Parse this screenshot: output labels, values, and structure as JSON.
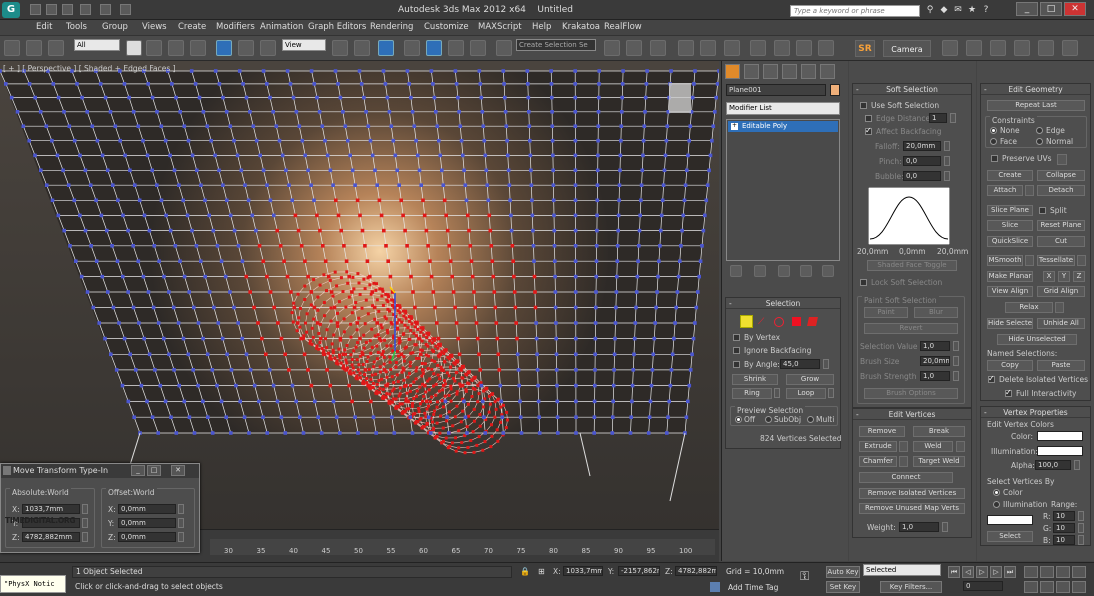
{
  "app": {
    "title": "Autodesk 3ds Max  2012 x64",
    "file": "Untitled",
    "search_placeholder": "Type a keyword or phrase"
  },
  "menu": [
    "Edit",
    "Tools",
    "Group",
    "Views",
    "Create",
    "Modifiers",
    "Animation",
    "Graph Editors",
    "Rendering",
    "Customize",
    "MAXScript",
    "Help",
    "Krakatoa",
    "RealFlow"
  ],
  "toolbar": {
    "selection_filter": "All",
    "ref_coord": "View",
    "named_selection": "Create Selection Se",
    "sr_label": "SR",
    "camera_label": "Camera"
  },
  "viewport": {
    "label": "[ + ] [ Perspective ] [ Shaded + Edged Faces ]"
  },
  "timeline": {
    "ticks": [
      "30",
      "35",
      "40",
      "45",
      "50",
      "55",
      "60",
      "65",
      "70",
      "75",
      "80",
      "85",
      "90",
      "95",
      "100"
    ]
  },
  "move_transform": {
    "title": "Move Transform Type-In",
    "absolute_label": "Absolute:World",
    "offset_label": "Offset:World",
    "abs_x": "1033,7mm",
    "abs_y": "",
    "abs_z": "4782,882mm",
    "off_x": "0,0mm",
    "off_y": "0,0mm",
    "off_z": "0,0mm",
    "x": "X:",
    "y": "Y:",
    "z": "Z:",
    "watermark": "TIMEDIGITAL.ORG"
  },
  "status": {
    "physx_notice": "\"PhysX Notic",
    "objects_selected": "1 Object Selected",
    "prompt": "Click or click-and-drag to select objects",
    "x": "1033,7mm",
    "y": "-2157,862r",
    "z": "4782,882m",
    "grid": "Grid = 10,0mm",
    "add_time_tag": "Add Time Tag",
    "auto_key": "Auto Key",
    "set_key": "Set Key",
    "selected": "Selected",
    "key_filters": "Key Filters...",
    "frame": "0"
  },
  "command_panel": {
    "object_name": "Plane001",
    "modifier_list": "Modifier List",
    "stack_item": "Editable Poly"
  },
  "selection_rollout": {
    "title": "Selection",
    "by_vertex": "By Vertex",
    "ignore_backfacing": "Ignore Backfacing",
    "by_angle": "By Angle:",
    "by_angle_value": "45,0",
    "shrink": "Shrink",
    "grow": "Grow",
    "ring": "Ring",
    "loop": "Loop",
    "preview_selection": "Preview Selection",
    "off": "Off",
    "subobj": "SubObj",
    "multi": "Multi",
    "count": "824 Vertices Selected"
  },
  "soft_selection": {
    "title": "Soft Selection",
    "use_soft_selection": "Use Soft Selection",
    "edge_distance": "Edge Distance:",
    "edge_distance_value": "1",
    "affect_backfacing": "Affect Backfacing",
    "falloff": "Falloff:",
    "falloff_value": "20,0mm",
    "pinch": "Pinch:",
    "pinch_value": "0,0",
    "bubble": "Bubble:",
    "bubble_value": "0,0",
    "curve_left": "20,0mm",
    "curve_mid": "0,0mm",
    "curve_right": "20,0mm",
    "shaded_face_toggle": "Shaded Face Toggle",
    "lock_soft_selection": "Lock Soft Selection",
    "paint_soft_selection": "Paint Soft Selection",
    "paint": "Paint",
    "blur": "Blur",
    "revert": "Revert",
    "selection_value": "Selection Value",
    "selection_value_v": "1,0",
    "brush_size": "Brush Size",
    "brush_size_v": "20,0mm",
    "brush_strength": "Brush Strength",
    "brush_strength_v": "1,0",
    "brush_options": "Brush Options"
  },
  "edit_vertices": {
    "title": "Edit Vertices",
    "remove": "Remove",
    "break": "Break",
    "extrude": "Extrude",
    "weld": "Weld",
    "chamfer": "Chamfer",
    "target_weld": "Target Weld",
    "connect": "Connect",
    "remove_isolated": "Remove Isolated Vertices",
    "remove_unused": "Remove Unused Map Verts",
    "weight": "Weight:",
    "weight_value": "1,0"
  },
  "edit_geometry": {
    "title": "Edit Geometry",
    "repeat_last": "Repeat Last",
    "constraints": "Constraints",
    "none": "None",
    "edge": "Edge",
    "face": "Face",
    "normal": "Normal",
    "preserve_uvs": "Preserve UVs",
    "create": "Create",
    "collapse": "Collapse",
    "attach": "Attach",
    "detach": "Detach",
    "slice_plane": "Slice Plane",
    "split": "Split",
    "slice": "Slice",
    "reset_plane": "Reset Plane",
    "quickslice": "QuickSlice",
    "cut": "Cut",
    "msmooth": "MSmooth",
    "tessellate": "Tessellate",
    "make_planar": "Make Planar",
    "x": "X",
    "y": "Y",
    "z": "Z",
    "view_align": "View Align",
    "grid_align": "Grid Align",
    "relax": "Relax",
    "hide_selected": "Hide Selected",
    "unhide_all": "Unhide All",
    "hide_unselected": "Hide Unselected",
    "named_selections": "Named Selections:",
    "copy": "Copy",
    "paste": "Paste",
    "delete_isolated": "Delete Isolated Vertices",
    "full_interactivity": "Full Interactivity"
  },
  "vertex_properties": {
    "title": "Vertex Properties",
    "edit_vertex_colors": "Edit Vertex Colors",
    "color": "Color:",
    "illumination": "Illumination:",
    "alpha": "Alpha:",
    "alpha_value": "100,0",
    "select_vertices_by": "Select Vertices By",
    "color_opt": "Color",
    "illumination_opt": "Illumination",
    "range": "Range:",
    "r": "R:",
    "g": "G:",
    "b": "B:",
    "r_value": "10",
    "g_value": "10",
    "b_value": "10",
    "select": "Select"
  },
  "colors": {
    "selected_vertex": "#e01818",
    "unselected_vertex": "#4a55d0",
    "mesh_edge": "#e8e8e8",
    "panel": "#4b4b4b",
    "accent_orange": "#f7a13a",
    "active_tool": "#2e6fb8"
  }
}
